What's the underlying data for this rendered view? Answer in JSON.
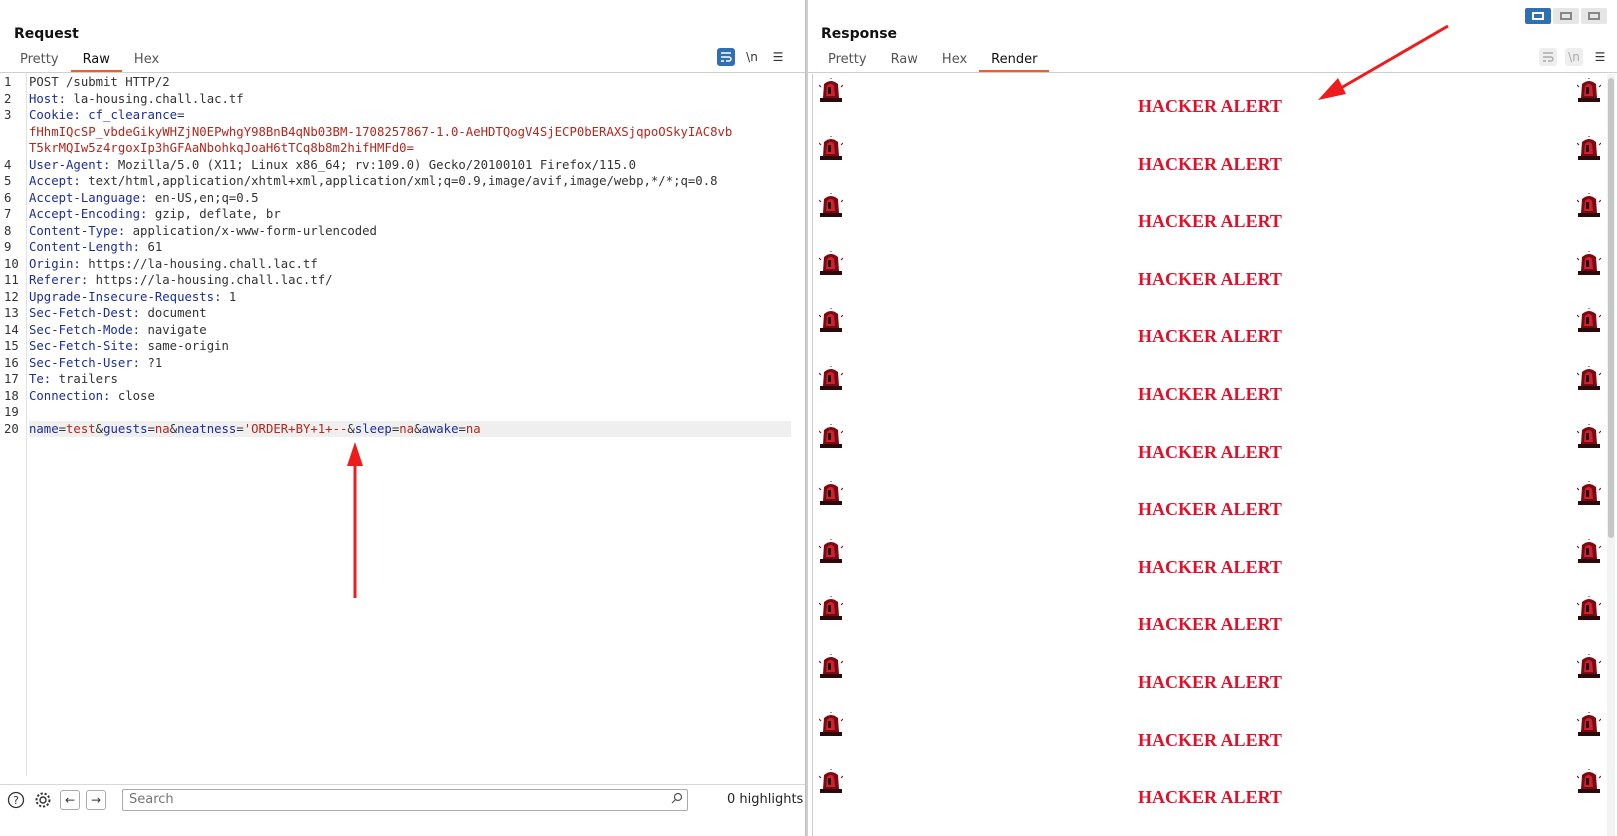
{
  "request": {
    "title": "Request",
    "tabs": [
      "Pretty",
      "Raw",
      "Hex"
    ],
    "active_tab": "Raw",
    "tool_icons": [
      "wrap-icon",
      "newline-icon",
      "menu-icon"
    ],
    "newline_label": "\\n",
    "lines": [
      {
        "n": "1",
        "parts": [
          [
            "v",
            "POST /submit HTTP/2"
          ]
        ]
      },
      {
        "n": "2",
        "parts": [
          [
            "k",
            "Host:"
          ],
          [
            "v",
            " la-housing.chall.lac.tf"
          ]
        ]
      },
      {
        "n": "3",
        "parts": [
          [
            "k",
            "Cookie:"
          ],
          [
            "v",
            " "
          ],
          [
            "k",
            "cf_clearance"
          ],
          [
            "v",
            "="
          ]
        ]
      },
      {
        "n": "",
        "parts": [
          [
            "red",
            "fHhmIQcSP_vbdeGikyWHZjN0EPwhgY98BnB4qNb03BM-1708257867-1.0-AeHDTQogV4SjECP0bERAXSjqpoOSkyIAC8vb"
          ]
        ]
      },
      {
        "n": "",
        "parts": [
          [
            "red",
            "T5krMQIw5z4rgoxIp3hGFAaNbohkqJoaH6tTCq8b8m2hifHMFd0="
          ]
        ]
      },
      {
        "n": "4",
        "parts": [
          [
            "k",
            "User-Agent:"
          ],
          [
            "v",
            " Mozilla/5.0 (X11; Linux x86_64; rv:109.0) Gecko/20100101 Firefox/115.0"
          ]
        ]
      },
      {
        "n": "5",
        "parts": [
          [
            "k",
            "Accept:"
          ],
          [
            "v",
            " text/html,application/xhtml+xml,application/xml;q=0.9,image/avif,image/webp,*/*;q=0.8"
          ]
        ]
      },
      {
        "n": "6",
        "parts": [
          [
            "k",
            "Accept-Language:"
          ],
          [
            "v",
            " en-US,en;q=0.5"
          ]
        ]
      },
      {
        "n": "7",
        "parts": [
          [
            "k",
            "Accept-Encoding:"
          ],
          [
            "v",
            " gzip, deflate, br"
          ]
        ]
      },
      {
        "n": "8",
        "parts": [
          [
            "k",
            "Content-Type:"
          ],
          [
            "v",
            " application/x-www-form-urlencoded"
          ]
        ]
      },
      {
        "n": "9",
        "parts": [
          [
            "k",
            "Content-Length:"
          ],
          [
            "v",
            " 61"
          ]
        ]
      },
      {
        "n": "10",
        "parts": [
          [
            "k",
            "Origin:"
          ],
          [
            "v",
            " https://la-housing.chall.lac.tf"
          ]
        ]
      },
      {
        "n": "11",
        "parts": [
          [
            "k",
            "Referer:"
          ],
          [
            "v",
            " https://la-housing.chall.lac.tf/"
          ]
        ]
      },
      {
        "n": "12",
        "parts": [
          [
            "k",
            "Upgrade-Insecure-Requests:"
          ],
          [
            "v",
            " 1"
          ]
        ]
      },
      {
        "n": "13",
        "parts": [
          [
            "k",
            "Sec-Fetch-Dest:"
          ],
          [
            "v",
            " document"
          ]
        ]
      },
      {
        "n": "14",
        "parts": [
          [
            "k",
            "Sec-Fetch-Mode:"
          ],
          [
            "v",
            " navigate"
          ]
        ]
      },
      {
        "n": "15",
        "parts": [
          [
            "k",
            "Sec-Fetch-Site:"
          ],
          [
            "v",
            " same-origin"
          ]
        ]
      },
      {
        "n": "16",
        "parts": [
          [
            "k",
            "Sec-Fetch-User:"
          ],
          [
            "v",
            " ?1"
          ]
        ]
      },
      {
        "n": "17",
        "parts": [
          [
            "k",
            "Te:"
          ],
          [
            "v",
            " trailers"
          ]
        ]
      },
      {
        "n": "18",
        "parts": [
          [
            "k",
            "Connection:"
          ],
          [
            "v",
            " close"
          ]
        ]
      },
      {
        "n": "19",
        "parts": []
      },
      {
        "n": "20",
        "parts": [
          [
            "k",
            "name"
          ],
          [
            "v",
            "="
          ],
          [
            "red",
            "test"
          ],
          [
            "v",
            "&"
          ],
          [
            "k",
            "guests"
          ],
          [
            "v",
            "="
          ],
          [
            "red",
            "na"
          ],
          [
            "v",
            "&"
          ],
          [
            "k",
            "neatness"
          ],
          [
            "v",
            "="
          ],
          [
            "red",
            "'ORDER+BY+1+--"
          ],
          [
            "v",
            "&"
          ],
          [
            "k",
            "sleep"
          ],
          [
            "v",
            "="
          ],
          [
            "red",
            "na"
          ],
          [
            "v",
            "&"
          ],
          [
            "k",
            "awake"
          ],
          [
            "v",
            "="
          ],
          [
            "red",
            "na"
          ]
        ],
        "current": true
      }
    ],
    "search_placeholder": "Search",
    "highlights": "0 highlights"
  },
  "response": {
    "title": "Response",
    "tabs": [
      "Pretty",
      "Raw",
      "Hex",
      "Render"
    ],
    "active_tab": "Render",
    "tool_icons": [
      "wrap-icon",
      "newline-icon",
      "menu-icon"
    ],
    "newline_label": "\\n",
    "alert_text": "HACKER ALERT",
    "alert_count": 13,
    "alert_color": "#e0102a"
  },
  "layout_buttons": [
    "split-horizontal-icon",
    "split-vertical-icon",
    "tabbed-icon"
  ],
  "accent_color": "#e8632a",
  "annotation_color": "#ee1c1c"
}
